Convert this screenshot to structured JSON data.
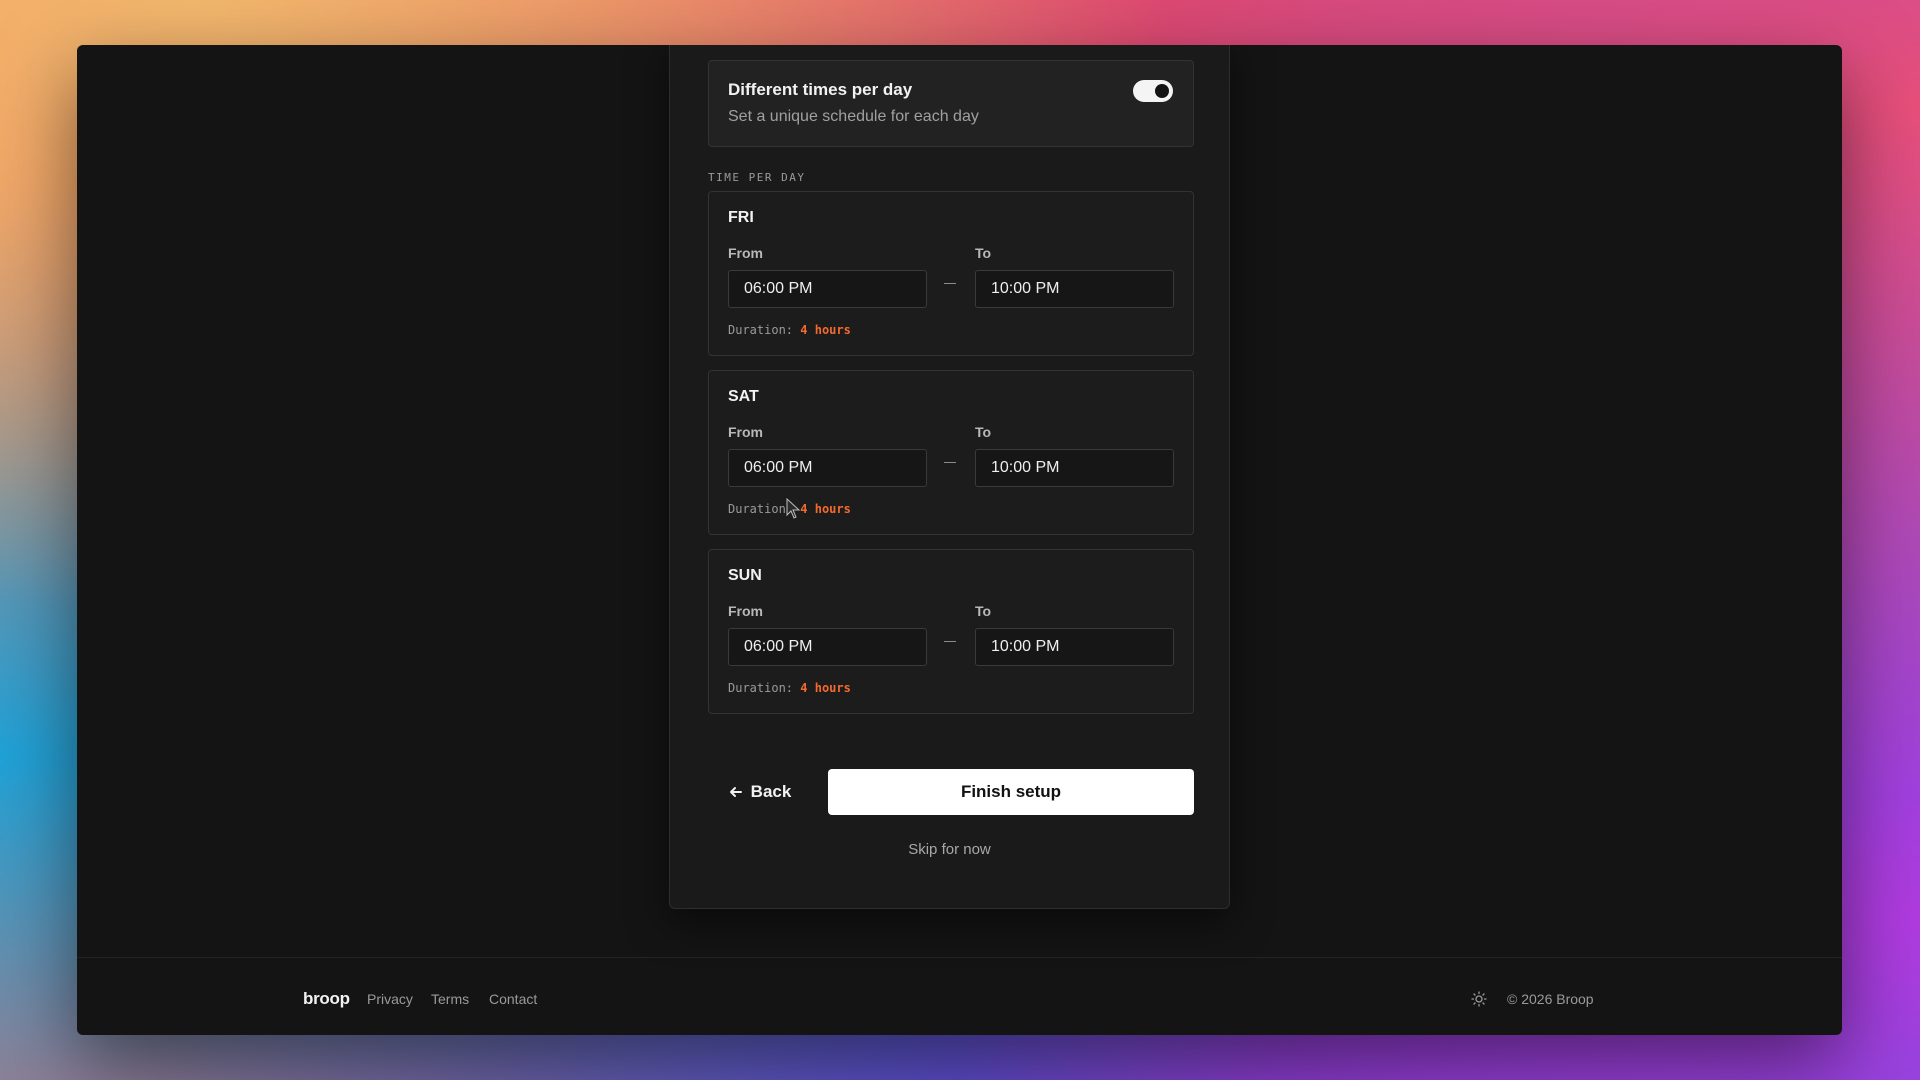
{
  "settings": {
    "toggle_title": "Different times per day",
    "toggle_subtitle": "Set a unique schedule for each day",
    "toggle_on": true
  },
  "section_label": "TIME PER DAY",
  "days": [
    {
      "name": "FRI",
      "from_label": "From",
      "to_label": "To",
      "from": "06:00 PM",
      "to": "10:00 PM",
      "duration_label": "Duration:",
      "duration": "4 hours"
    },
    {
      "name": "SAT",
      "from_label": "From",
      "to_label": "To",
      "from": "06:00 PM",
      "to": "10:00 PM",
      "duration_label": "Duration:",
      "duration": "4 hours"
    },
    {
      "name": "SUN",
      "from_label": "From",
      "to_label": "To",
      "from": "06:00 PM",
      "to": "10:00 PM",
      "duration_label": "Duration:",
      "duration": "4 hours"
    }
  ],
  "actions": {
    "back_label": "Back",
    "finish_label": "Finish setup",
    "skip_label": "Skip for now"
  },
  "footer": {
    "logo": "broop",
    "links": [
      "Privacy",
      "Terms",
      "Contact"
    ],
    "copyright": "© 2026 Broop"
  },
  "colors": {
    "accent": "#f46a2e",
    "window_bg": "#141414",
    "primary_button": "#ffffff"
  }
}
